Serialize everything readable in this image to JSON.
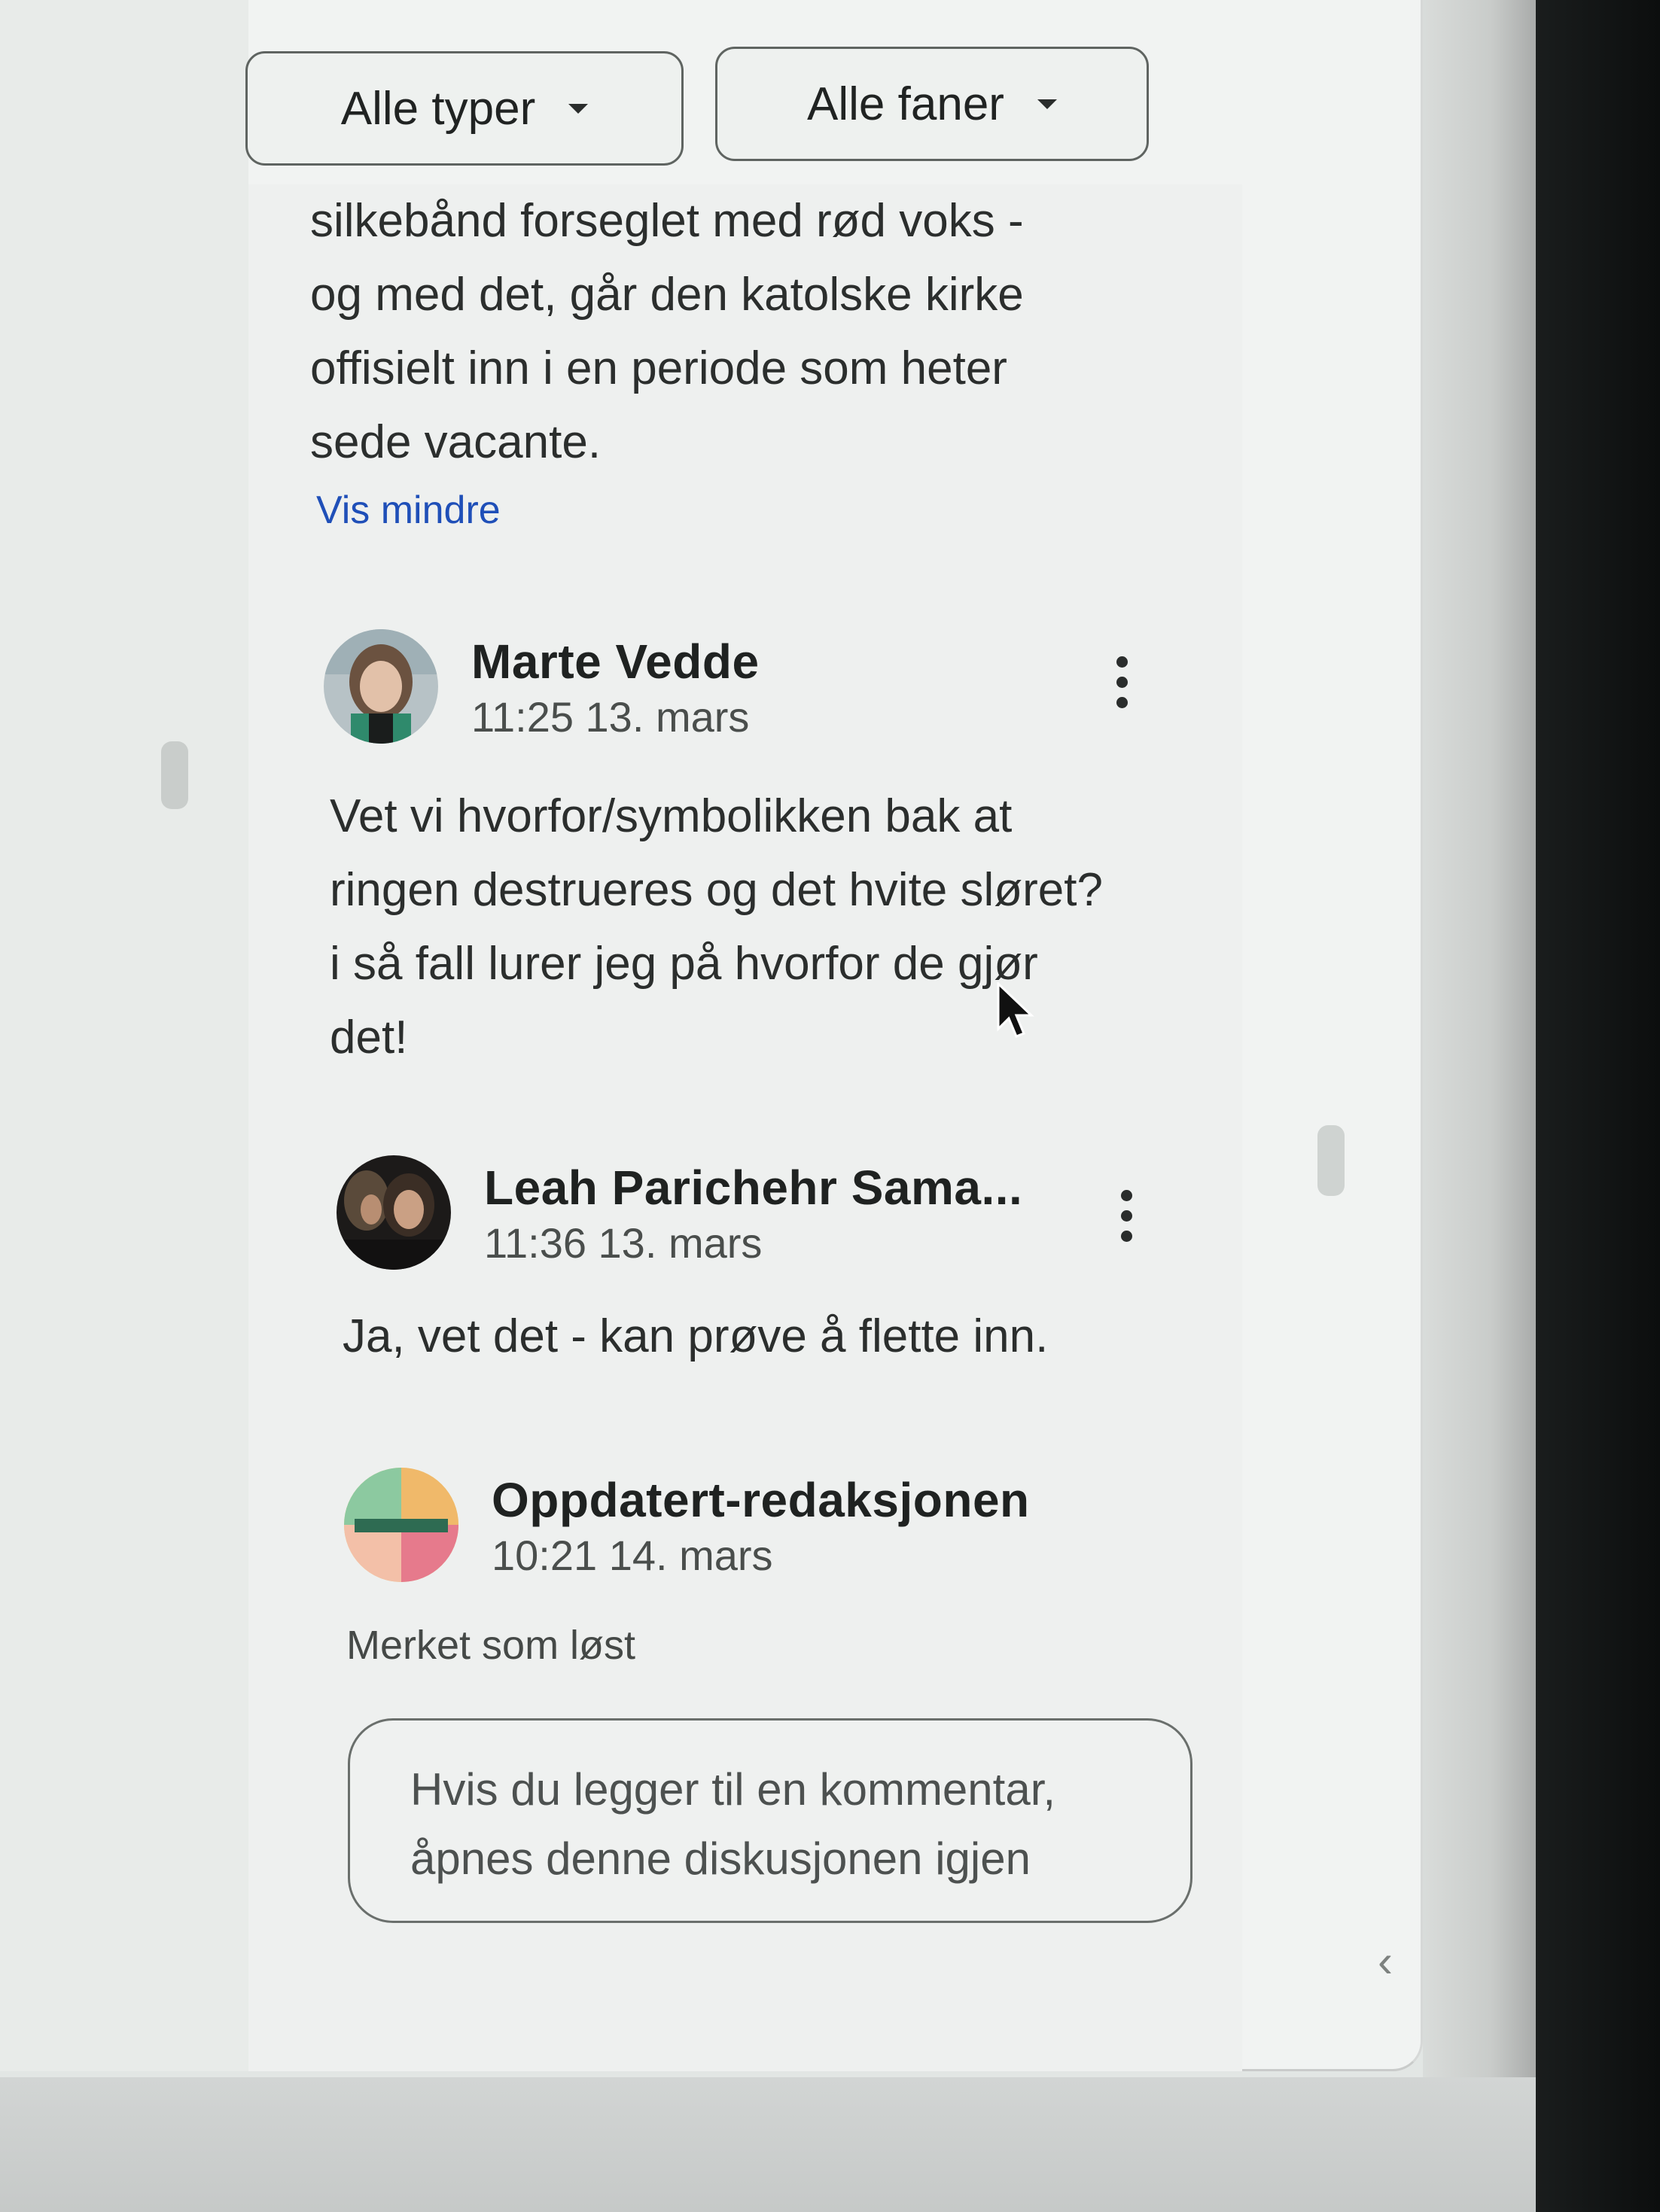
{
  "filters": {
    "types_label": "Alle typer",
    "tabs_label": "Alle faner"
  },
  "description": {
    "text": "silkebånd forseglet med rød voks -\nog med det, går den katolske kirke\noffisielt inn i en periode som heter\nsede vacante.",
    "show_less_label": "Vis mindre"
  },
  "comments": [
    {
      "author": "Marte Vedde",
      "time": "11:25 13. mars",
      "text": "Vet vi hvorfor/symbolikken bak at\nringen destrueres og det hvite sløret?\ni så fall lurer jeg på hvorfor de gjør\ndet!"
    },
    {
      "author": "Leah Parichehr Sama...",
      "time": "11:36 13. mars",
      "text": "Ja, vet det - kan prøve å flette inn."
    },
    {
      "author": "Oppdatert-redaksjonen",
      "time": "10:21 14. mars",
      "text": ""
    }
  ],
  "status": {
    "resolved_label": "Merket som løst"
  },
  "reply": {
    "placeholder": "Hvis du legger til en kommentar,\nåpnes denne diskusjonen igjen"
  },
  "icons": {
    "dropdown": "caret-down-icon",
    "more": "more-vert-icon",
    "collapse": "chevron-left-icon",
    "collapse_glyph": "‹"
  },
  "colors": {
    "link": "#1f4fb8",
    "text": "#2b2e2d",
    "panel": "#f1f3f2"
  }
}
